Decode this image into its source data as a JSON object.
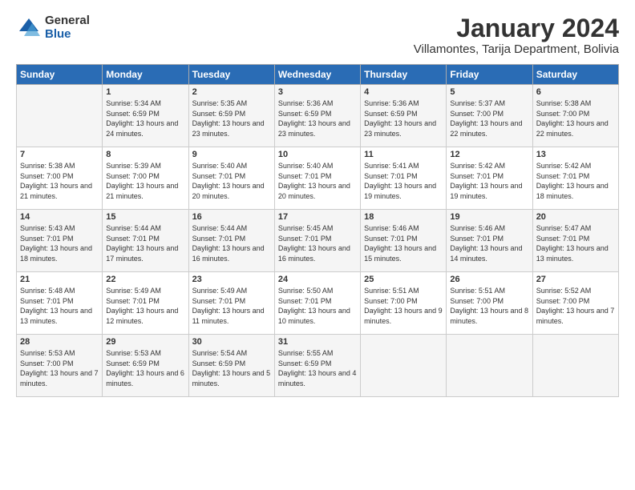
{
  "header": {
    "logo_general": "General",
    "logo_blue": "Blue",
    "month_title": "January 2024",
    "location": "Villamontes, Tarija Department, Bolivia"
  },
  "days_of_week": [
    "Sunday",
    "Monday",
    "Tuesday",
    "Wednesday",
    "Thursday",
    "Friday",
    "Saturday"
  ],
  "weeks": [
    [
      {
        "num": "",
        "sunrise": "",
        "sunset": "",
        "daylight": ""
      },
      {
        "num": "1",
        "sunrise": "Sunrise: 5:34 AM",
        "sunset": "Sunset: 6:59 PM",
        "daylight": "Daylight: 13 hours and 24 minutes."
      },
      {
        "num": "2",
        "sunrise": "Sunrise: 5:35 AM",
        "sunset": "Sunset: 6:59 PM",
        "daylight": "Daylight: 13 hours and 23 minutes."
      },
      {
        "num": "3",
        "sunrise": "Sunrise: 5:36 AM",
        "sunset": "Sunset: 6:59 PM",
        "daylight": "Daylight: 13 hours and 23 minutes."
      },
      {
        "num": "4",
        "sunrise": "Sunrise: 5:36 AM",
        "sunset": "Sunset: 6:59 PM",
        "daylight": "Daylight: 13 hours and 23 minutes."
      },
      {
        "num": "5",
        "sunrise": "Sunrise: 5:37 AM",
        "sunset": "Sunset: 7:00 PM",
        "daylight": "Daylight: 13 hours and 22 minutes."
      },
      {
        "num": "6",
        "sunrise": "Sunrise: 5:38 AM",
        "sunset": "Sunset: 7:00 PM",
        "daylight": "Daylight: 13 hours and 22 minutes."
      }
    ],
    [
      {
        "num": "7",
        "sunrise": "Sunrise: 5:38 AM",
        "sunset": "Sunset: 7:00 PM",
        "daylight": "Daylight: 13 hours and 21 minutes."
      },
      {
        "num": "8",
        "sunrise": "Sunrise: 5:39 AM",
        "sunset": "Sunset: 7:00 PM",
        "daylight": "Daylight: 13 hours and 21 minutes."
      },
      {
        "num": "9",
        "sunrise": "Sunrise: 5:40 AM",
        "sunset": "Sunset: 7:01 PM",
        "daylight": "Daylight: 13 hours and 20 minutes."
      },
      {
        "num": "10",
        "sunrise": "Sunrise: 5:40 AM",
        "sunset": "Sunset: 7:01 PM",
        "daylight": "Daylight: 13 hours and 20 minutes."
      },
      {
        "num": "11",
        "sunrise": "Sunrise: 5:41 AM",
        "sunset": "Sunset: 7:01 PM",
        "daylight": "Daylight: 13 hours and 19 minutes."
      },
      {
        "num": "12",
        "sunrise": "Sunrise: 5:42 AM",
        "sunset": "Sunset: 7:01 PM",
        "daylight": "Daylight: 13 hours and 19 minutes."
      },
      {
        "num": "13",
        "sunrise": "Sunrise: 5:42 AM",
        "sunset": "Sunset: 7:01 PM",
        "daylight": "Daylight: 13 hours and 18 minutes."
      }
    ],
    [
      {
        "num": "14",
        "sunrise": "Sunrise: 5:43 AM",
        "sunset": "Sunset: 7:01 PM",
        "daylight": "Daylight: 13 hours and 18 minutes."
      },
      {
        "num": "15",
        "sunrise": "Sunrise: 5:44 AM",
        "sunset": "Sunset: 7:01 PM",
        "daylight": "Daylight: 13 hours and 17 minutes."
      },
      {
        "num": "16",
        "sunrise": "Sunrise: 5:44 AM",
        "sunset": "Sunset: 7:01 PM",
        "daylight": "Daylight: 13 hours and 16 minutes."
      },
      {
        "num": "17",
        "sunrise": "Sunrise: 5:45 AM",
        "sunset": "Sunset: 7:01 PM",
        "daylight": "Daylight: 13 hours and 16 minutes."
      },
      {
        "num": "18",
        "sunrise": "Sunrise: 5:46 AM",
        "sunset": "Sunset: 7:01 PM",
        "daylight": "Daylight: 13 hours and 15 minutes."
      },
      {
        "num": "19",
        "sunrise": "Sunrise: 5:46 AM",
        "sunset": "Sunset: 7:01 PM",
        "daylight": "Daylight: 13 hours and 14 minutes."
      },
      {
        "num": "20",
        "sunrise": "Sunrise: 5:47 AM",
        "sunset": "Sunset: 7:01 PM",
        "daylight": "Daylight: 13 hours and 13 minutes."
      }
    ],
    [
      {
        "num": "21",
        "sunrise": "Sunrise: 5:48 AM",
        "sunset": "Sunset: 7:01 PM",
        "daylight": "Daylight: 13 hours and 13 minutes."
      },
      {
        "num": "22",
        "sunrise": "Sunrise: 5:49 AM",
        "sunset": "Sunset: 7:01 PM",
        "daylight": "Daylight: 13 hours and 12 minutes."
      },
      {
        "num": "23",
        "sunrise": "Sunrise: 5:49 AM",
        "sunset": "Sunset: 7:01 PM",
        "daylight": "Daylight: 13 hours and 11 minutes."
      },
      {
        "num": "24",
        "sunrise": "Sunrise: 5:50 AM",
        "sunset": "Sunset: 7:01 PM",
        "daylight": "Daylight: 13 hours and 10 minutes."
      },
      {
        "num": "25",
        "sunrise": "Sunrise: 5:51 AM",
        "sunset": "Sunset: 7:00 PM",
        "daylight": "Daylight: 13 hours and 9 minutes."
      },
      {
        "num": "26",
        "sunrise": "Sunrise: 5:51 AM",
        "sunset": "Sunset: 7:00 PM",
        "daylight": "Daylight: 13 hours and 8 minutes."
      },
      {
        "num": "27",
        "sunrise": "Sunrise: 5:52 AM",
        "sunset": "Sunset: 7:00 PM",
        "daylight": "Daylight: 13 hours and 7 minutes."
      }
    ],
    [
      {
        "num": "28",
        "sunrise": "Sunrise: 5:53 AM",
        "sunset": "Sunset: 7:00 PM",
        "daylight": "Daylight: 13 hours and 7 minutes."
      },
      {
        "num": "29",
        "sunrise": "Sunrise: 5:53 AM",
        "sunset": "Sunset: 6:59 PM",
        "daylight": "Daylight: 13 hours and 6 minutes."
      },
      {
        "num": "30",
        "sunrise": "Sunrise: 5:54 AM",
        "sunset": "Sunset: 6:59 PM",
        "daylight": "Daylight: 13 hours and 5 minutes."
      },
      {
        "num": "31",
        "sunrise": "Sunrise: 5:55 AM",
        "sunset": "Sunset: 6:59 PM",
        "daylight": "Daylight: 13 hours and 4 minutes."
      },
      {
        "num": "",
        "sunrise": "",
        "sunset": "",
        "daylight": ""
      },
      {
        "num": "",
        "sunrise": "",
        "sunset": "",
        "daylight": ""
      },
      {
        "num": "",
        "sunrise": "",
        "sunset": "",
        "daylight": ""
      }
    ]
  ]
}
